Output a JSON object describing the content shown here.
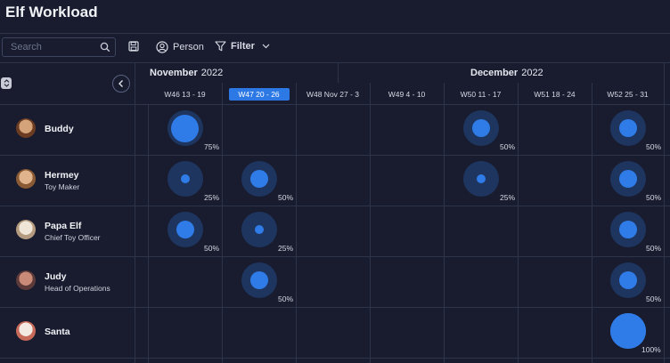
{
  "app": {
    "title": "Elf Workload"
  },
  "toolbar": {
    "search_placeholder": "Search",
    "person_label": "Person",
    "filter_label": "Filter"
  },
  "timeline": {
    "months": [
      {
        "name": "November",
        "year": "2022"
      },
      {
        "name": "December",
        "year": "2022"
      }
    ],
    "weeks": [
      {
        "label": "W46  13 - 19",
        "active": false
      },
      {
        "label": "W47  20 - 26",
        "active": true
      },
      {
        "label": "W48  Nov 27 - 3",
        "active": false
      },
      {
        "label": "W49  4 - 10",
        "active": false
      },
      {
        "label": "W50  11 - 17",
        "active": false
      },
      {
        "label": "W51  18 - 24",
        "active": false
      },
      {
        "label": "W52  25 - 31",
        "active": false
      }
    ]
  },
  "people": [
    {
      "name": "Buddy",
      "role": "",
      "workload": [
        75,
        null,
        null,
        null,
        50,
        null,
        50
      ]
    },
    {
      "name": "Hermey",
      "role": "Toy Maker",
      "workload": [
        25,
        50,
        null,
        null,
        25,
        null,
        50
      ]
    },
    {
      "name": "Papa Elf",
      "role": "Chief Toy Officer",
      "workload": [
        50,
        25,
        null,
        null,
        null,
        null,
        50
      ]
    },
    {
      "name": "Judy",
      "role": "Head of Operations",
      "workload": [
        null,
        50,
        null,
        null,
        null,
        null,
        50
      ]
    },
    {
      "name": "Santa",
      "role": "",
      "workload": [
        null,
        null,
        null,
        null,
        null,
        null,
        100
      ]
    }
  ],
  "colors": {
    "accent": "#2f7ce8",
    "bubble_ring": "#1e3560",
    "background": "#181c2e"
  }
}
